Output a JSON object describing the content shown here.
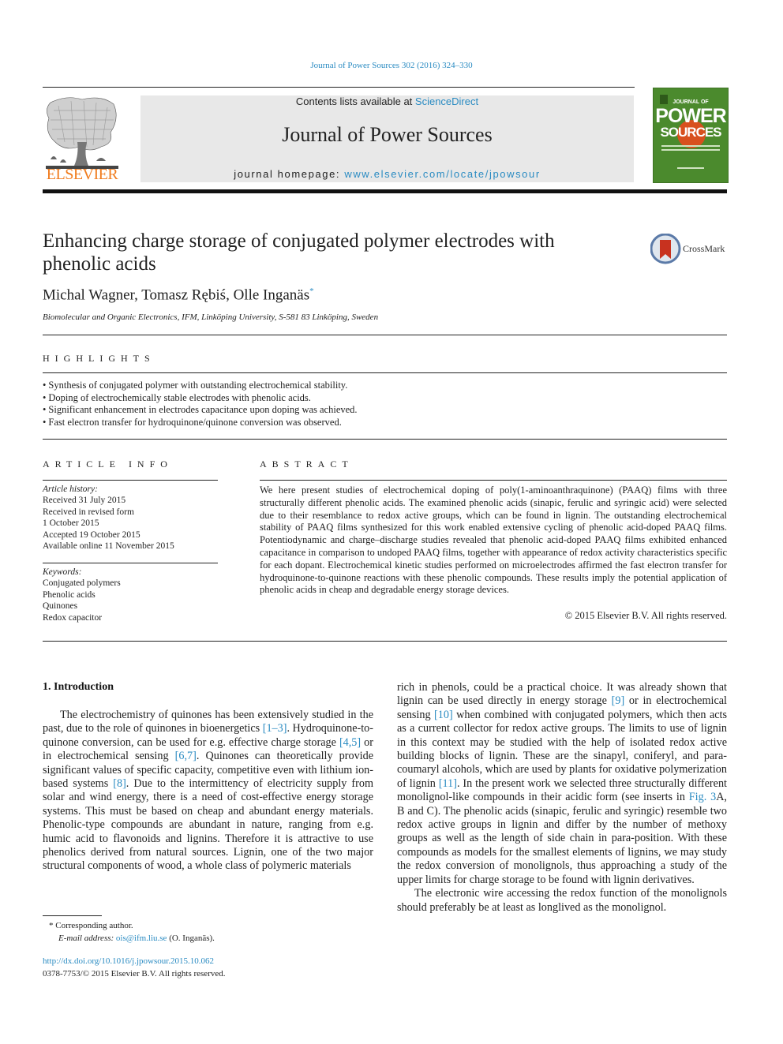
{
  "header": {
    "journal_ref": "Journal of Power Sources 302 (2016) 324–330",
    "contents_prefix": "Contents lists available at ",
    "contents_link": "ScienceDirect",
    "journal_name": "Journal of Power Sources",
    "homepage_prefix": "journal homepage: ",
    "homepage_link": "www.elsevier.com/locate/jpowsour",
    "publisher_logo": "ELSEVIER",
    "cover": {
      "line1": "JOURNAL OF",
      "line2": "POWER",
      "line3": "SOURCES"
    },
    "colors": {
      "link": "#2a8bc2",
      "elsevier_orange": "#f07c1e",
      "cover_green": "#4b8a2d",
      "banner_gray": "#e8e8e8"
    }
  },
  "article": {
    "title": "Enhancing charge storage of conjugated polymer electrodes with phenolic acids",
    "crossmark_label": "CrossMark",
    "authors": "Michal Wagner, Tomasz Rębiś, Olle Inganäs",
    "corresponding_mark": "*",
    "affiliation": "Biomolecular and Organic Electronics, IFM, Linköping University, S-581 83 Linköping, Sweden"
  },
  "highlights": {
    "heading": "HIGHLIGHTS",
    "items": [
      "Synthesis of conjugated polymer with outstanding electrochemical stability.",
      "Doping of electrochemically stable electrodes with phenolic acids.",
      "Significant enhancement in electrodes capacitance upon doping was achieved.",
      "Fast electron transfer for hydroquinone/quinone conversion was observed."
    ]
  },
  "article_info": {
    "heading": "ARTICLE INFO",
    "history_label": "Article history:",
    "history": [
      "Received 31 July 2015",
      "Received in revised form",
      "1 October 2015",
      "Accepted 19 October 2015",
      "Available online 11 November 2015"
    ],
    "keywords_label": "Keywords:",
    "keywords": [
      "Conjugated polymers",
      "Phenolic acids",
      "Quinones",
      "Redox capacitor"
    ]
  },
  "abstract": {
    "heading": "ABSTRACT",
    "text": "We here present studies of electrochemical doping of poly(1-aminoanthraquinone) (PAAQ) films with three structurally different phenolic acids. The examined phenolic acids (sinapic, ferulic and syringic acid) were selected due to their resemblance to redox active groups, which can be found in lignin. The outstanding electrochemical stability of PAAQ films synthesized for this work enabled extensive cycling of phenolic acid-doped PAAQ films. Potentiodynamic and charge–discharge studies revealed that phenolic acid-doped PAAQ films exhibited enhanced capacitance in comparison to undoped PAAQ films, together with appearance of redox activity characteristics specific for each dopant. Electrochemical kinetic studies performed on microelectrodes affirmed the fast electron transfer for hydroquinone-to-quinone reactions with these phenolic compounds. These results imply the potential application of phenolic acids in cheap and degradable energy storage devices.",
    "copyright": "© 2015 Elsevier B.V. All rights reserved."
  },
  "introduction": {
    "heading": "1.  Introduction",
    "left_col": {
      "p1_a": "The electrochemistry of quinones has been extensively studied in the past, due to the role of quinones in bioenergetics ",
      "ref1": "[1–3]",
      "p1_b": ". Hydroquinone-to-quinone conversion, can be used for e.g. effective charge storage ",
      "ref2": "[4,5]",
      "p1_c": " or in electrochemical sensing ",
      "ref3": "[6,7]",
      "p1_d": ". Quinones can theoretically provide significant values of specific capacity, competitive even with lithium ion-based systems ",
      "ref4": "[8]",
      "p1_e": ". Due to the intermittency of electricity supply from solar and wind energy, there is a need of cost-effective energy storage systems. This must be based on cheap and abundant energy materials. Phenolic-type compounds are abundant in nature, ranging from e.g. humic acid to flavonoids and lignins. Therefore it is attractive to use phenolics derived from natural sources. Lignin, one of the two major structural components of wood, a whole class of polymeric materials"
    },
    "right_col": {
      "p1_a": "rich in phenols, could be a practical choice. It was already shown that lignin can be used directly in energy storage ",
      "ref5": "[9]",
      "p1_b": " or in electrochemical sensing ",
      "ref6": "[10]",
      "p1_c": " when combined with conjugated polymers, which then acts as a current collector for redox active groups. The limits to use of lignin in this context may be studied with the help of isolated redox active building blocks of lignin. These are the sinapyl, coniferyl, and para-coumaryl alcohols, which are used by plants for oxidative polymerization of lignin ",
      "ref7": "[11]",
      "p1_d": ". In the present work we selected three structurally different monolignol-like compounds in their acidic form (see inserts in ",
      "fig_ref": "Fig. 3",
      "p1_e": "A, B and C). The phenolic acids (sinapic, ferulic and syringic) resemble two redox active groups in lignin and differ by the number of methoxy groups as well as the length of side chain in para-position. With these compounds as models for the smallest elements of lignins, we may study the redox conversion of monolignols, thus approaching a study of the upper limits for charge storage to be found with lignin derivatives.",
      "p2": "The electronic wire accessing the redox function of the monolignols should preferably be at least as longlived as the monolignol."
    }
  },
  "footnotes": {
    "corresponding": "* Corresponding author.",
    "email_label": "E-mail address: ",
    "email": "ois@ifm.liu.se",
    "email_suffix": " (O. Inganäs).",
    "doi": "http://dx.doi.org/10.1016/j.jpowsour.2015.10.062",
    "issn": "0378-7753/© 2015 Elsevier B.V. All rights reserved."
  }
}
